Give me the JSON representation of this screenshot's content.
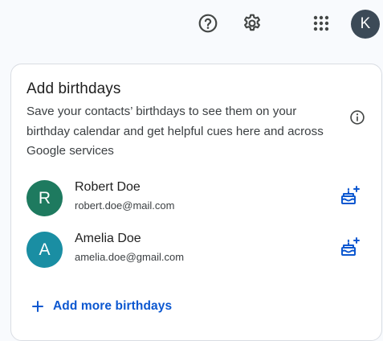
{
  "header": {
    "icons": [
      "help-icon",
      "settings-gear-icon",
      "apps-grid-icon"
    ],
    "account_initial": "K",
    "account_color": "#3c4a57"
  },
  "card": {
    "title": "Add birthdays",
    "description": "Save your contacts’ birthdays to see them on your birthday calendar and get helpful cues here and across Google services",
    "info_icon": "info-icon",
    "contacts": [
      {
        "initial": "R",
        "name": "Robert Doe",
        "email": "robert.doe@mail.com",
        "avatar_color": "#1e7a5f",
        "action_icon": "add-birthday-cake-icon"
      },
      {
        "initial": "A",
        "name": "Amelia Doe",
        "email": "amelia.doe@gmail.com",
        "avatar_color": "#1a8ea3",
        "action_icon": "add-birthday-cake-icon"
      }
    ],
    "add_more_label": "Add more birthdays",
    "accent_color": "#0b57d0"
  }
}
